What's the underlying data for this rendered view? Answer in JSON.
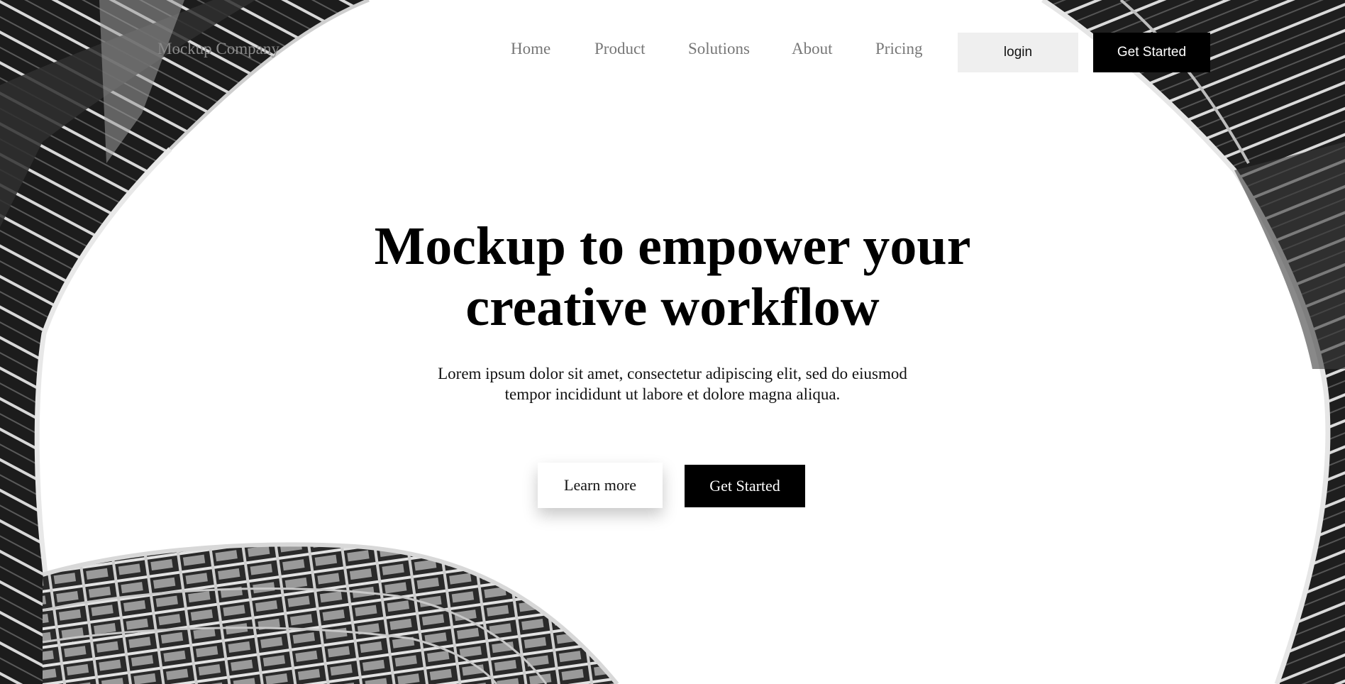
{
  "header": {
    "brand": "Mockup Company",
    "nav": [
      "Home",
      "Product",
      "Solutions",
      "About",
      "Pricing"
    ],
    "login_label": "login",
    "get_started_label": "Get Started"
  },
  "hero": {
    "headline_line1": "Mockup to empower your",
    "headline_line2": "creative workflow",
    "subtitle_line1": "Lorem ipsum dolor sit amet, consectetur adipiscing elit, sed do eiusmod",
    "subtitle_line2": "tempor incididunt ut labore et dolore magna aliqua.",
    "learn_more_label": "Learn more",
    "get_started_label": "Get Started"
  },
  "colors": {
    "background": "#ffffff",
    "primary": "#000000",
    "secondary_button": "#efefef",
    "nav_text": "#777777"
  }
}
